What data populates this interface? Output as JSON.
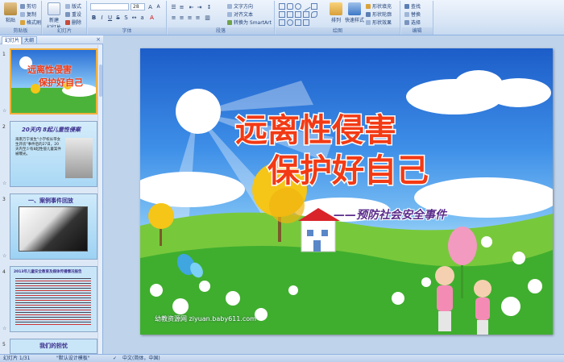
{
  "ribbon": {
    "clipboard": {
      "paste": "粘贴",
      "cut": "剪切",
      "copy": "复制",
      "format_painter": "格式刷",
      "label": "剪贴板"
    },
    "slides": {
      "new_slide": "新建",
      "new_slide2": "幻灯片",
      "layout": "版式",
      "reset": "重设",
      "delete": "删除",
      "label": "幻灯片"
    },
    "font": {
      "font_size": "28",
      "label": "字体"
    },
    "paragraph": {
      "text_direction": "文字方向",
      "align_text": "对齐文本",
      "smartart": "转换为 SmartArt",
      "label": "段落"
    },
    "drawing": {
      "arrange": "排列",
      "quick_styles": "快速样式",
      "shape_fill": "形状填充",
      "shape_outline": "形状轮廓",
      "shape_effects": "形状效果",
      "label": "绘图"
    },
    "editing": {
      "find": "查找",
      "replace": "替换",
      "select": "选择",
      "label": "编辑"
    }
  },
  "leftpane": {
    "tab_slides": "幻灯片",
    "tab_outline": "大纲",
    "close": "×",
    "thumbs": [
      {
        "num": "1",
        "line1": "远离性侵害",
        "line2": "保护好自己"
      },
      {
        "num": "2",
        "title": "20天内 8起儿童性侵案",
        "body": "海南万宁发生\"小学校长带女生开房\"事件后的27日，20天内至少有8起性侵儿童案件被曝光。"
      },
      {
        "num": "3",
        "title": "一、案例事件回放"
      },
      {
        "num": "4",
        "title": "2013年儿童安全教育及媒体传播情况报告"
      },
      {
        "num": "5",
        "title": "我们的担忧"
      }
    ]
  },
  "slide": {
    "title_line1": "远离性侵害",
    "title_line2": "保护好自己",
    "subtitle": "——预防社会安全事件",
    "watermark": "幼教资源网 ziyuan.baby611.com"
  },
  "statusbar": {
    "slide_count": "幻灯片 1/31",
    "theme": "\"默认设计模板\"",
    "language": "中文(简体，中国)"
  },
  "colors": {
    "title_red": "#f23a15",
    "subtitle_purple": "#5b2d8c",
    "sky_top": "#1c5dc9",
    "grass": "#3fae2e"
  }
}
